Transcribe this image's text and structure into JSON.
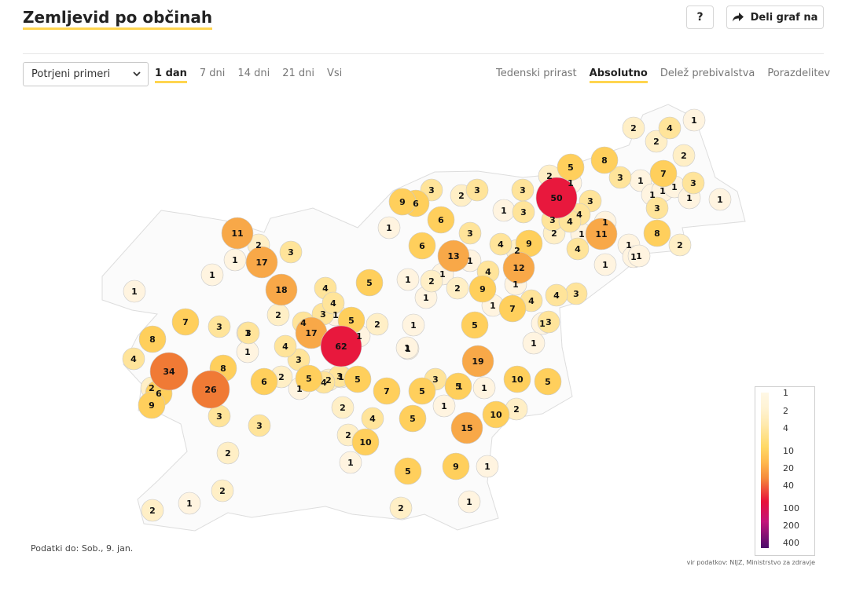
{
  "header": {
    "title": "Zemljevid po občinah",
    "help_label": "?",
    "share_label": "Deli graf na"
  },
  "controls": {
    "measure_select_value": "Potrjeni primeri",
    "time_tabs": [
      "1 dan",
      "7 dni",
      "14 dni",
      "21 dni",
      "Vsi"
    ],
    "time_active": "1 dan",
    "mode_tabs": [
      "Tedenski prirast",
      "Absolutno",
      "Delež prebivalstva",
      "Porazdelitev"
    ],
    "mode_active": "Absolutno"
  },
  "legend": {
    "ticks": [
      "1",
      "2",
      "4",
      "10",
      "20",
      "40",
      "100",
      "200",
      "400"
    ]
  },
  "footer": {
    "data_date": "Podatki do: Sob., 9. jan.",
    "source": "vir podatkov: NIJZ, Ministrstvo za zdravje"
  },
  "colors": {
    "accent": "#ffd54f",
    "empty": "#ffffff",
    "c1": "#fff4e0",
    "c2": "#ffefc6",
    "c4": "#ffe49a",
    "c10": "#ffcf5c",
    "c20": "#f8a848",
    "c40": "#f07a35",
    "c60": "#e8183d"
  },
  "map_counts": [
    2,
    4,
    1,
    2,
    2,
    1,
    8,
    5,
    2,
    1,
    7,
    3,
    3,
    1,
    1,
    1,
    1,
    3,
    9,
    3,
    3,
    6,
    2,
    1,
    3,
    3,
    50,
    1,
    3,
    4,
    6,
    4,
    3,
    1,
    1,
    3,
    1,
    1,
    1,
    11,
    1,
    4,
    4,
    2,
    2,
    8,
    1,
    11,
    2,
    2,
    17,
    3,
    1,
    1,
    6,
    13,
    1,
    4,
    9,
    2,
    5,
    1,
    2,
    1,
    18,
    4,
    12,
    1,
    3,
    4,
    9,
    2,
    1,
    4,
    1,
    1,
    4,
    1,
    7,
    3,
    1,
    17,
    5,
    2,
    3,
    4,
    1,
    3,
    7,
    3,
    4,
    1,
    8,
    1,
    62,
    1,
    1,
    1,
    4,
    3,
    19,
    1,
    5,
    8,
    2,
    3,
    5,
    1,
    4,
    1,
    5,
    3,
    6,
    34,
    26,
    2,
    10,
    6,
    5,
    7,
    5,
    1,
    1,
    9,
    2,
    4,
    3,
    3,
    2,
    15,
    1,
    10,
    10,
    2,
    5,
    2,
    2,
    1,
    9,
    5,
    1,
    2,
    2,
    1,
    1,
    2,
    5
  ]
}
